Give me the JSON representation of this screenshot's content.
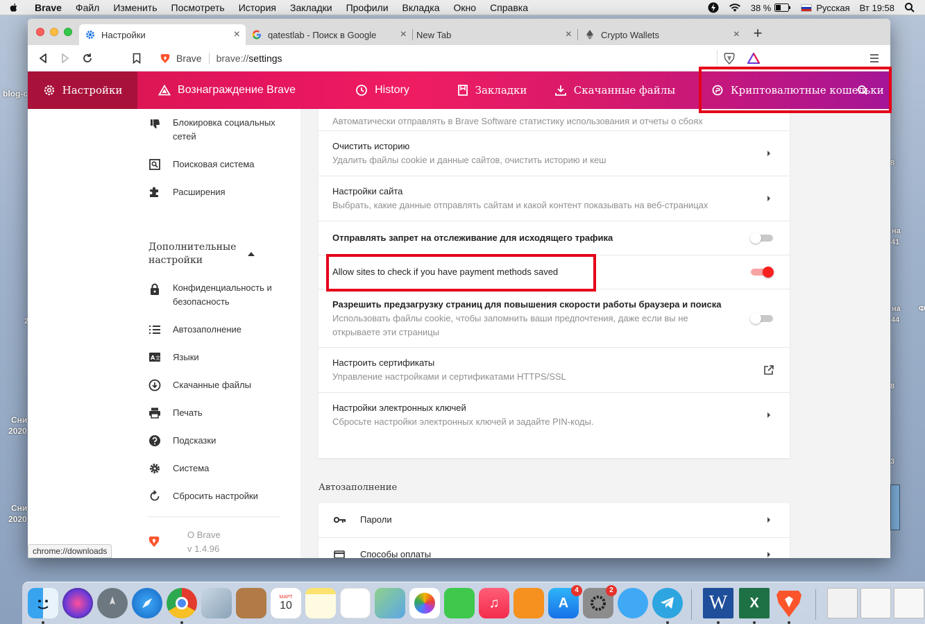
{
  "menubar": {
    "app": "Brave",
    "items": [
      "Файл",
      "Изменить",
      "Посмотреть",
      "История",
      "Закладки",
      "Профили",
      "Вкладка",
      "Окно",
      "Справка"
    ],
    "battery": "38 %",
    "keyboard": "Русская",
    "clock": "Вт 19:58"
  },
  "tabs": [
    {
      "title": "Настройки",
      "icon": "gear-icon"
    },
    {
      "title": "qatestlab - Поиск в Google",
      "icon": "google-icon"
    },
    {
      "title": "New Tab",
      "icon": ""
    },
    {
      "title": "Crypto Wallets",
      "icon": "ethereum-icon"
    }
  ],
  "omnibox": {
    "site": "Brave",
    "url_prefix": "brave://",
    "url_path": "settings"
  },
  "navbar": {
    "items": [
      {
        "label": "Настройки",
        "icon": "gear-icon"
      },
      {
        "label": "Вознаграждение Brave",
        "icon": "triangle-icon"
      },
      {
        "label": "History",
        "icon": "clock-icon"
      },
      {
        "label": "Закладки",
        "icon": "bookmark-icon"
      },
      {
        "label": "Скачанные файлы",
        "icon": "download-icon"
      },
      {
        "label": "Криптовалютные кошельки",
        "icon": "wallet-icon"
      }
    ],
    "colors": {
      "start": "#d5194b",
      "end": "#a51596",
      "selected": "#a8123a"
    }
  },
  "sidebar": {
    "items_top": [
      {
        "label": "Блокировка социальных сетей",
        "icon": "thumbs-down-icon"
      },
      {
        "label": "Поисковая система",
        "icon": "search-box-icon"
      },
      {
        "label": "Расширения",
        "icon": "puzzle-icon"
      }
    ],
    "advanced_label": "Дополнительные настройки",
    "items_adv": [
      {
        "label": "Конфиденциальность и безопасность",
        "icon": "lock-icon"
      },
      {
        "label": "Автозаполнение",
        "icon": "list-icon"
      },
      {
        "label": "Языки",
        "icon": "language-icon"
      },
      {
        "label": "Скачанные файлы",
        "icon": "download-circle-icon"
      },
      {
        "label": "Печать",
        "icon": "printer-icon"
      },
      {
        "label": "Подсказки",
        "icon": "help-icon"
      },
      {
        "label": "Система",
        "icon": "gear-icon"
      },
      {
        "label": "Сбросить настройки",
        "icon": "reset-icon"
      }
    ],
    "about": "О Brave",
    "version": "v 1.4.96"
  },
  "privacy_rows": {
    "partial_sub": "Автоматически отправлять в Brave Software статистику использования и отчеты о сбоях",
    "clear_title": "Очистить историю",
    "clear_sub": "Удалить файлы cookie и данные сайтов, очистить историю и кеш",
    "site_title": "Настройки сайта",
    "site_sub": "Выбрать, какие данные отправлять сайтам и какой контент показывать на веб-страницах",
    "dnt_title": "Отправлять запрет на отслеживание для исходящего трафика",
    "dnt_on": false,
    "payment_title": "Allow sites to check if you have payment methods saved",
    "payment_on": true,
    "preload_title": "Разрешить предзагрузку страниц для повышения скорости работы браузера и поиска",
    "preload_sub1": "Использовать файлы cookie, чтобы запомнить ваши предпочтения, даже если вы не",
    "preload_sub2": "открываете эти страницы",
    "preload_on": false,
    "cert_title": "Настроить сертификаты",
    "cert_sub": "Управление настройками и сертификатами HTTPS/SSL",
    "keys_title": "Настройки электронных ключей",
    "keys_sub": "Сбросьте настройки электронных ключей и задайте PIN-коды."
  },
  "autofill": {
    "section_title": "Автозаполнение",
    "passwords": "Пароли",
    "payments": "Способы оплаты"
  },
  "status_url": "chrome://downloads",
  "desktop": {
    "labels": [
      "blog-c",
      "Сни",
      "2020",
      "Сни",
      "2020"
    ],
    "fragments": [
      "8",
      "на",
      "41",
      "на",
      "44",
      "Ф",
      "2",
      "8",
      "3"
    ]
  },
  "dock": {
    "calendar_month": "МАРТ",
    "calendar_day": "10",
    "appstore_badge": "4",
    "prefs_badge": "2",
    "word": "W",
    "excel": "X"
  },
  "accent": {
    "toggle_on": "#fa2020",
    "highlight": "#e5001a"
  }
}
